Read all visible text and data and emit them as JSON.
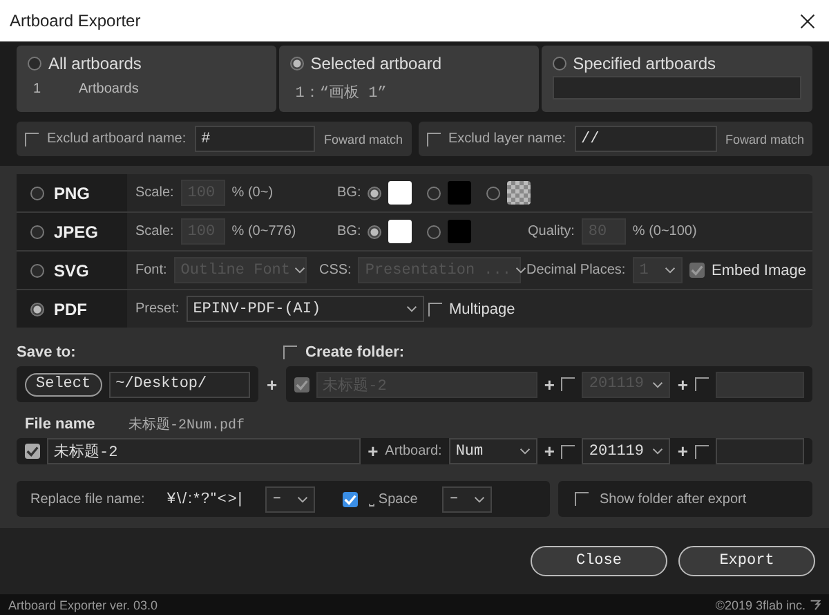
{
  "window": {
    "title": "Artboard Exporter"
  },
  "targets": [
    {
      "label": "All artboards",
      "selected": false,
      "kind": "count",
      "count": "1",
      "unit": "Artboards"
    },
    {
      "label": "Selected artboard",
      "selected": true,
      "kind": "name",
      "value": "1：“画板 1”"
    },
    {
      "label": "Specified artboards",
      "selected": false,
      "kind": "field"
    }
  ],
  "exclusions": [
    {
      "label": "Exclud artboard name:",
      "checked": false,
      "value": "#",
      "match": "Foward match"
    },
    {
      "label": "Exclud layer name:",
      "checked": false,
      "value": "//",
      "match": "Foward match"
    }
  ],
  "formats": [
    {
      "label": "PNG",
      "kind": "png",
      "selected": false,
      "groups": [
        [
          {
            "kind": "label",
            "text": "Scale:"
          },
          {
            "kind": "input",
            "value": "100",
            "disabled": true
          },
          {
            "kind": "label",
            "text": "% (0~)"
          }
        ],
        [
          {
            "kind": "label",
            "text": "BG:"
          },
          {
            "kind": "swatch",
            "color": "#ffffff",
            "selected": true
          },
          {
            "kind": "swatch",
            "color": "#000000",
            "selected": false
          },
          {
            "kind": "checker",
            "selected": false
          }
        ]
      ]
    },
    {
      "label": "JPEG",
      "kind": "jpeg",
      "selected": false,
      "groups": [
        [
          {
            "kind": "label",
            "text": "Scale:"
          },
          {
            "kind": "input",
            "value": "100",
            "disabled": true
          },
          {
            "kind": "label",
            "text": "% (0~776)"
          }
        ],
        [
          {
            "kind": "label",
            "text": "BG:"
          },
          {
            "kind": "swatch",
            "color": "#ffffff",
            "selected": true
          },
          {
            "kind": "swatch",
            "color": "#000000",
            "selected": false
          }
        ],
        [
          {
            "kind": "label",
            "text": "Quality:"
          },
          {
            "kind": "input",
            "value": "80",
            "disabled": true
          },
          {
            "kind": "label",
            "text": "% (0~100)"
          }
        ]
      ]
    },
    {
      "label": "SVG",
      "kind": "svg",
      "selected": false,
      "groups": [
        [
          {
            "kind": "label",
            "text": "Font:"
          },
          {
            "kind": "select",
            "value": "Outline Font",
            "disabled": true
          }
        ],
        [
          {
            "kind": "label",
            "text": "CSS:"
          },
          {
            "kind": "select",
            "value": "Presentation ...",
            "disabled": true
          }
        ],
        [
          {
            "kind": "label",
            "text": "Decimal Places:"
          },
          {
            "kind": "select",
            "value": "1",
            "disabled": true
          }
        ],
        [
          {
            "kind": "check",
            "checked": true,
            "disabled": true,
            "label": "Embed Image"
          }
        ]
      ]
    },
    {
      "label": "PDF",
      "kind": "pdf",
      "selected": true,
      "groups": [
        [
          {
            "kind": "label",
            "text": "Preset:"
          },
          {
            "kind": "select",
            "value": "EPINV-PDF-(AI)",
            "disabled": false
          }
        ],
        [
          {
            "kind": "check",
            "checked": false,
            "disabled": false,
            "label": "Multipage"
          }
        ]
      ]
    }
  ],
  "save_to": {
    "label": "Save to:",
    "button": "Select",
    "path": "~/Desktop/",
    "plus": "+"
  },
  "create_folder": {
    "label": "Create folder:",
    "checked": false,
    "items": [
      {
        "kind": "check",
        "checked": true,
        "disabled": true
      },
      {
        "kind": "input",
        "value": "未标题-2",
        "disabled": true
      },
      {
        "kind": "plus",
        "text": "+"
      },
      {
        "kind": "check",
        "checked": false,
        "disabled": false
      },
      {
        "kind": "select",
        "value": "201119",
        "disabled": true
      },
      {
        "kind": "plus",
        "text": "+"
      },
      {
        "kind": "check",
        "checked": false,
        "disabled": false
      },
      {
        "kind": "input",
        "disabled": true
      }
    ]
  },
  "file_name": {
    "label": "File name",
    "preview": "未标题-2Num.pdf",
    "items": [
      {
        "kind": "check",
        "checked": true,
        "disabled": false
      },
      {
        "kind": "input",
        "value": "未标题-2",
        "disabled": false
      },
      {
        "kind": "plus",
        "text": "+"
      },
      {
        "kind": "label",
        "text": "Artboard:"
      },
      {
        "kind": "select",
        "value": "Num",
        "disabled": false
      },
      {
        "kind": "plus",
        "text": "+"
      },
      {
        "kind": "check",
        "checked": false,
        "disabled": false
      },
      {
        "kind": "select",
        "value": "201119",
        "disabled": false
      },
      {
        "kind": "plus",
        "text": "+"
      },
      {
        "kind": "check",
        "checked": false,
        "disabled": false
      },
      {
        "kind": "input",
        "disabled": false
      }
    ]
  },
  "replace": {
    "label": "Replace file name:",
    "chars": "¥\\/:*?\"<>|",
    "replacement": "–",
    "space_checked": true,
    "space_label": "⎵ Space",
    "space_replacement": "–"
  },
  "show_folder": {
    "label": "Show folder after export",
    "checked": false
  },
  "buttons": [
    "Close",
    "Export"
  ],
  "footer": {
    "version": "Artboard Exporter ver. 03.0",
    "copyright": "©2019 3flab inc."
  }
}
